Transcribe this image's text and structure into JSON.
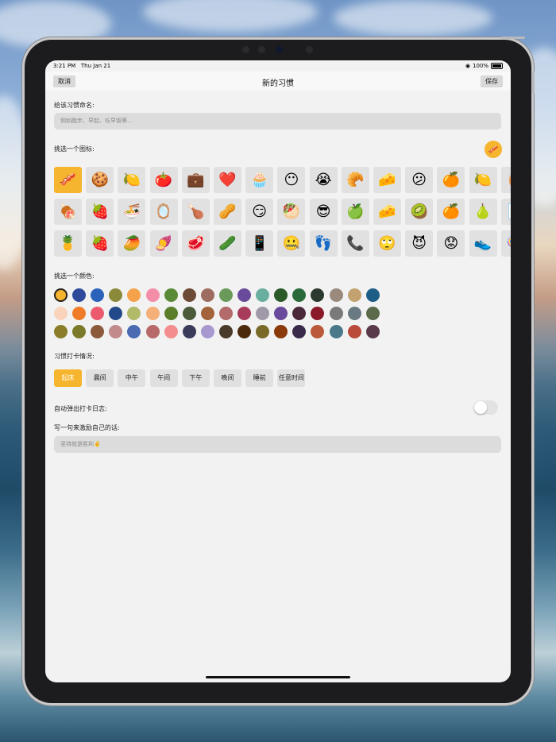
{
  "status_bar": {
    "time": "3:21 PM",
    "date": "Thu Jan 21",
    "battery": "100%"
  },
  "nav": {
    "cancel_label": "取消",
    "title": "新的习惯",
    "save_label": "保存"
  },
  "name_section": {
    "label": "给该习惯命名:",
    "placeholder": "例如跑步、早起、吃早饭等..."
  },
  "icon_section": {
    "label": "挑选一个图标:",
    "selected_index": 0,
    "icons": [
      [
        "🥓",
        "🍪",
        "🍋",
        "🍅",
        "💼",
        "❤️",
        "🧁",
        "😶",
        "😭",
        "🥐",
        "🧀",
        "😕",
        "🍊",
        "🍋",
        "🥚"
      ],
      [
        "🍖",
        "🍓",
        "🍜",
        "🪞",
        "🍗",
        "🥜",
        "😏",
        "🥙",
        "😎",
        "🍏",
        "🧀",
        "🥝",
        "🍊",
        "🍐",
        "📄"
      ],
      [
        "🍍",
        "🍓",
        "🥭",
        "🍠",
        "🥩",
        "🥒",
        "📱",
        "🤐",
        "👣",
        "📞",
        "🙄",
        "😈",
        "😟",
        "👟",
        "🍭"
      ]
    ]
  },
  "color_section": {
    "label": "挑选一个颜色:",
    "selected_index": 0,
    "colors": [
      [
        "#f5b52e",
        "#2f4a9a",
        "#2b63ba",
        "#8a8a3a",
        "#f5a24a",
        "#f48ea8",
        "#5a8a36",
        "#6b4a36",
        "#9e6c60",
        "#6a9a5a",
        "#6a4a9a",
        "#6aaea0",
        "#2c5a2a",
        "#2a6a3a",
        "#2a3a2e",
        "#9a8a7e",
        "#c2a26e",
        "#1e5e86"
      ],
      [
        "#f9d3bc",
        "#f07c2a",
        "#ec5a6e",
        "#224a8a",
        "#b2ba6a",
        "#f5b07a",
        "#5a7e2a",
        "#4a5a3a",
        "#a2623a",
        "#b26a6a",
        "#a83a5a",
        "#a09aa8",
        "#6a4a9a",
        "#4a2a3a",
        "#8a1a2a",
        "#7a7a7a",
        "#6a7a82",
        "#5a6a4a"
      ],
      [
        "#8a7e2a",
        "#7a7a2a",
        "#8a5a3a",
        "#c28a8a",
        "#4a6ab2",
        "#b86a6a",
        "#f48e8e",
        "#3a3a5a",
        "#a898d0",
        "#4a3a2a",
        "#4a2a0a",
        "#7a6a2a",
        "#8a3a0a",
        "#3a2a4a",
        "#ba5a3a",
        "#4a7a8a",
        "#ba4a3a",
        "#5a3a4a"
      ]
    ]
  },
  "time_section": {
    "label": "习惯打卡情况:",
    "selected_index": 0,
    "options": [
      "起床",
      "晨间",
      "中午",
      "午间",
      "下午",
      "晚间",
      "睡前",
      "任意时间"
    ]
  },
  "auto_log": {
    "label": "自动弹出打卡日志:",
    "enabled": false
  },
  "motto_section": {
    "label": "写一句来激励自己的话:",
    "value": "坚持就是胜利✌️"
  }
}
